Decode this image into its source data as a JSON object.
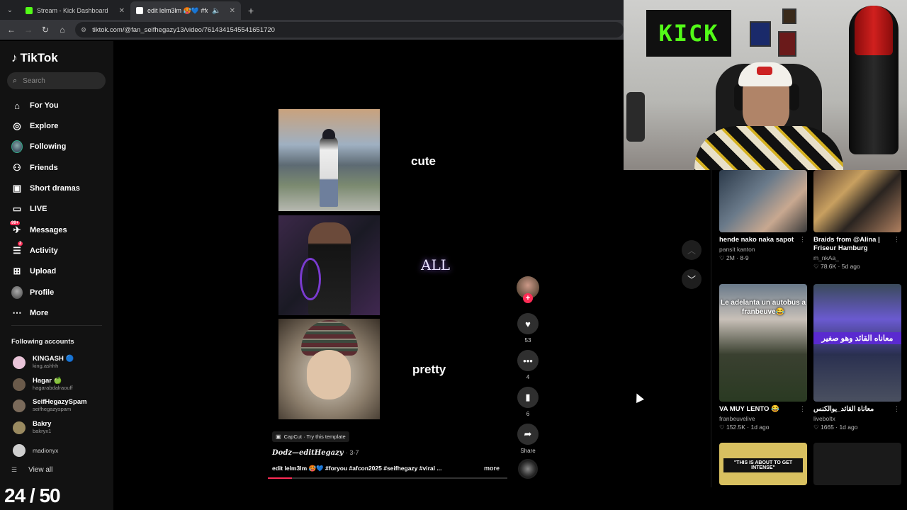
{
  "browser": {
    "tabs": [
      {
        "title": "Stream - Kick Dashboard",
        "favicon_color": "#53fc18",
        "active": false
      },
      {
        "title": "edit lelm3lm 🥵💙 #foryou",
        "favicon_color": "#ffffff",
        "active": true
      }
    ],
    "url": "tiktok.com/@fan_seifhegazy13/video/7614341545541651720"
  },
  "sidebar": {
    "brand": "TikTok",
    "search_placeholder": "Search",
    "nav": [
      {
        "label": "For You",
        "icon": "home-icon"
      },
      {
        "label": "Explore",
        "icon": "compass-icon"
      },
      {
        "label": "Following",
        "icon": "avatar-icon"
      },
      {
        "label": "Friends",
        "icon": "friends-icon"
      },
      {
        "label": "Short dramas",
        "icon": "drama-icon"
      },
      {
        "label": "LIVE",
        "icon": "live-icon"
      },
      {
        "label": "Messages",
        "icon": "messages-icon",
        "badge": "99+"
      },
      {
        "label": "Activity",
        "icon": "activity-icon",
        "badge": "2"
      },
      {
        "label": "Upload",
        "icon": "upload-icon"
      },
      {
        "label": "Profile",
        "icon": "profile-icon"
      },
      {
        "label": "More",
        "icon": "more-icon"
      }
    ],
    "following_title": "Following accounts",
    "accounts": [
      {
        "name": "KINGASH 🔵",
        "handle": "king.ashhh",
        "color": "#e9c4d8"
      },
      {
        "name": "Hagar 🍏",
        "handle": "hagarabdalraouff",
        "color": "#6a5a4a"
      },
      {
        "name": "SeifHegazySpam",
        "handle": "seifhegazyspam",
        "color": "#7a6a5a"
      },
      {
        "name": "Bakry",
        "handle": "bakryx1",
        "color": "#9a8a60"
      },
      {
        "name": "madionyx",
        "handle": "",
        "color": "#cfcfcf"
      }
    ],
    "view_all": "View all"
  },
  "video": {
    "words": [
      "cute",
      "ALL",
      "pretty"
    ],
    "template_label": "CapCut · Try this template",
    "author": "Dodz—editHegazy",
    "date": "· 3-7",
    "caption": "edit lelm3lm 🥵💙 #foryou #afcon2025 #seifhegazy #viral ...",
    "more": "more",
    "progress": 0.1
  },
  "actions": {
    "likes": "53",
    "comments": "4",
    "saves": "6",
    "share": "Share"
  },
  "recommendations": [
    {
      "title": "hende nako naka sapot",
      "user": "pansit kanton",
      "meta": "♡ 2M · 8-9"
    },
    {
      "title": "Braids from @Alina | Friseur Hamburg",
      "user": "m_nkAa_",
      "meta": "♡ 78.6K · 5d ago"
    },
    {
      "title": "VA MUY LENTO 😂",
      "user": "franbeuvelive",
      "meta": "♡ 152.5K · 1d ago",
      "thumb_text": "Le adelanta un autobus a franbeuve😂"
    },
    {
      "title": "معاناة القائد_يوالكنس",
      "user": "liveboltx",
      "meta": "♡ 1665 · 1d ago",
      "thumb_text": "معاناه القائد وهو صغير"
    },
    {
      "title": "",
      "user": "",
      "meta": "",
      "thumb_text": "\"THIS IS ABOUT TO GET INTENSE\""
    },
    {
      "title": "",
      "user": "",
      "meta": ""
    }
  ],
  "webcam": {
    "poster_text": "KICK"
  },
  "overlay_counter": "24 / 50",
  "colors": {
    "accent": "#fe2c55",
    "kick_green": "#53fc18"
  }
}
